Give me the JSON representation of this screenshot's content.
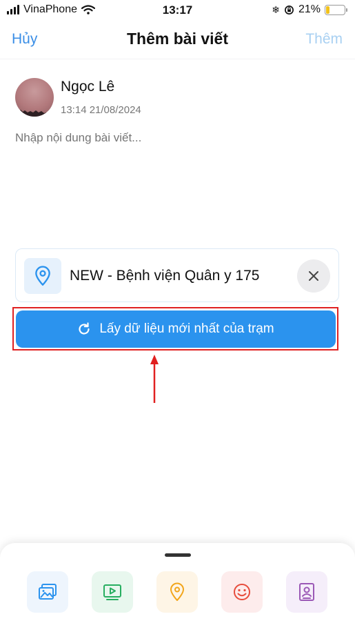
{
  "status": {
    "carrier": "VinaPhone",
    "time": "13:17",
    "battery_percent": "21%",
    "battery_level": 0.21,
    "battery_color": "#f2c21b"
  },
  "nav": {
    "cancel_label": "Hủy",
    "title": "Thêm bài viết",
    "add_label": "Thêm"
  },
  "author": {
    "name": "Ngọc Lê",
    "timestamp": "13:14 21/08/2024"
  },
  "post": {
    "placeholder": "Nhập nội dung bài viết...",
    "value": ""
  },
  "location": {
    "name": "NEW - Bệnh viện Quân y 175",
    "icon": "map-pin-icon",
    "remove_icon": "close-icon"
  },
  "refresh_button": {
    "label": "Lấy dữ liệu mới nhất của trạm",
    "icon": "refresh-icon",
    "color": "#2b93ee"
  },
  "toolbar": {
    "items": [
      {
        "icon": "image-icon",
        "color": "#2b93ee",
        "bg": "#eef5fd"
      },
      {
        "icon": "video-icon",
        "color": "#27ae60",
        "bg": "#e8f7ee"
      },
      {
        "icon": "location-icon",
        "color": "#f2a51a",
        "bg": "#fef5e6"
      },
      {
        "icon": "emoji-icon",
        "color": "#e74c3c",
        "bg": "#fdecec"
      },
      {
        "icon": "contact-icon",
        "color": "#9b59b6",
        "bg": "#f5eefa"
      }
    ]
  },
  "colors": {
    "accent": "#3a8ee6",
    "annotation_red": "#e02020"
  }
}
